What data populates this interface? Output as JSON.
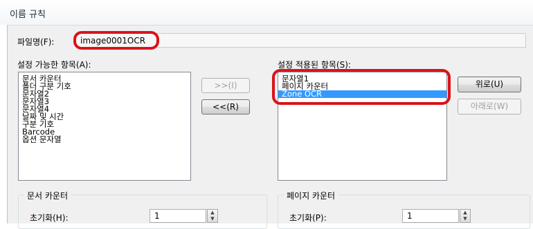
{
  "window": {
    "title": "이름 규칙"
  },
  "filename": {
    "label": "파일명(F):",
    "value": "image0001OCR"
  },
  "available": {
    "label": "설정 가능한 항목(A):",
    "items": [
      "문서 카운터",
      "폴더 구분 기호",
      "문자열2",
      "문자열3",
      "문자열4",
      "날짜 및 시간",
      "구분 기호",
      "Barcode",
      "옵션 문자열"
    ]
  },
  "buttons": {
    "add": ">>(I)",
    "remove": "<<(R)",
    "up": "위로(U)",
    "down": "아래로(W)"
  },
  "applied": {
    "label": "설정 적용된 항목(S):",
    "items": [
      "문자열1",
      "페이지 카운터",
      "Zone OCR"
    ],
    "selected_index": 2
  },
  "doc_counter": {
    "title": "문서 카운터",
    "label": "초기화(H):",
    "value": "1"
  },
  "page_counter": {
    "title": "페이지 카운터",
    "label": "초기화(P):",
    "value": "1"
  },
  "colors": {
    "highlight": "#d8141a",
    "selection": "#3399ff"
  }
}
